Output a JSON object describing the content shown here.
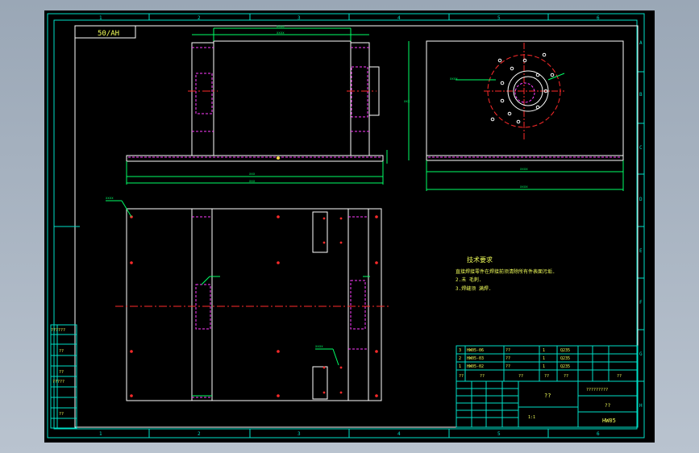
{
  "drawing": {
    "title_tag": "50/AH",
    "drawing_number": "HW05",
    "col_labels": [
      "1",
      "2",
      "3",
      "4",
      "5",
      "6"
    ],
    "row_labels": [
      "A",
      "B",
      "C",
      "D",
      "E",
      "F",
      "G",
      "H"
    ],
    "tech_requirements": {
      "heading": "技术要求",
      "lines": [
        "直接焊接零件在焊接前须清除所有件表面污垢.",
        "2.未 毛刺.",
        "3.焊缝须 满焊."
      ]
    },
    "bom": [
      {
        "idx": "3",
        "code": "HW05-06",
        "name": "??",
        "qty": "1",
        "material": "Q235"
      },
      {
        "idx": "2",
        "code": "HW05-03",
        "name": "??",
        "qty": "1",
        "material": "Q235"
      },
      {
        "idx": "1",
        "code": "HW05-02",
        "name": "??",
        "qty": "1",
        "material": "Q235"
      }
    ],
    "bom_header": [
      "??",
      "??",
      "??",
      "??",
      "??",
      "??"
    ],
    "title_block": {
      "center_label": "??",
      "company": "?????????",
      "part_name": "??",
      "scale_row": "1:1",
      "number_field": "HW05"
    },
    "left_table": [
      "??????",
      "??",
      "??",
      "?????",
      "??"
    ],
    "dims": {
      "top_width": "xxxx",
      "inner_width": "xxxx",
      "base_width": "xxx",
      "base_total": "xxx",
      "side_width": "xxxx",
      "side_total": "xxxx",
      "height": "xxx"
    },
    "note_leaders": [
      "xxxx",
      "xxxx",
      "xxxx"
    ]
  },
  "colors": {
    "frame": "#00e0c8",
    "line": "#ffffff",
    "center": "#ff2a2a",
    "magenta": "#ff3cff",
    "dim": "#00ff66",
    "text": "#f2ff5a"
  }
}
